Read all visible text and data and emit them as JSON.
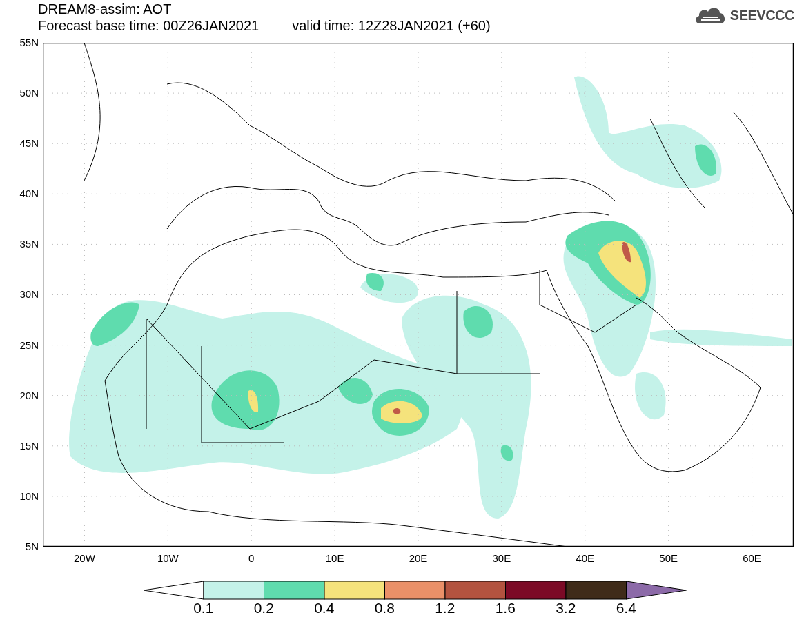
{
  "title": {
    "line_1": "DREAM8-assim: AOT",
    "base_time": "Forecast base time: 00Z26JAN2021",
    "valid_time": "valid time: 12Z28JAN2021 (+60)"
  },
  "logo": {
    "text": "SEEVCCC"
  },
  "map": {
    "latitude_labels": [
      "55N",
      "50N",
      "45N",
      "40N",
      "35N",
      "30N",
      "25N",
      "20N",
      "15N",
      "10N",
      "5N"
    ],
    "longitude_labels": [
      "20W",
      "10W",
      "0",
      "10E",
      "20E",
      "30E",
      "40E",
      "50E",
      "60E"
    ]
  },
  "colorbar": {
    "segments": [
      {
        "kind": "under",
        "color": "#ffffff"
      },
      {
        "kind": "box",
        "color": "#c4f2e9"
      },
      {
        "kind": "box",
        "color": "#5fdcae"
      },
      {
        "kind": "box",
        "color": "#f5e37c"
      },
      {
        "kind": "box",
        "color": "#ea9068"
      },
      {
        "kind": "box",
        "color": "#b3533f"
      },
      {
        "kind": "box",
        "color": "#7c0a26"
      },
      {
        "kind": "box",
        "color": "#3f2b19"
      },
      {
        "kind": "over",
        "color": "#8c6aa8"
      }
    ],
    "labels": [
      "0.1",
      "0.2",
      "0.4",
      "0.8",
      "1.2",
      "1.6",
      "3.2",
      "6.4"
    ]
  }
}
